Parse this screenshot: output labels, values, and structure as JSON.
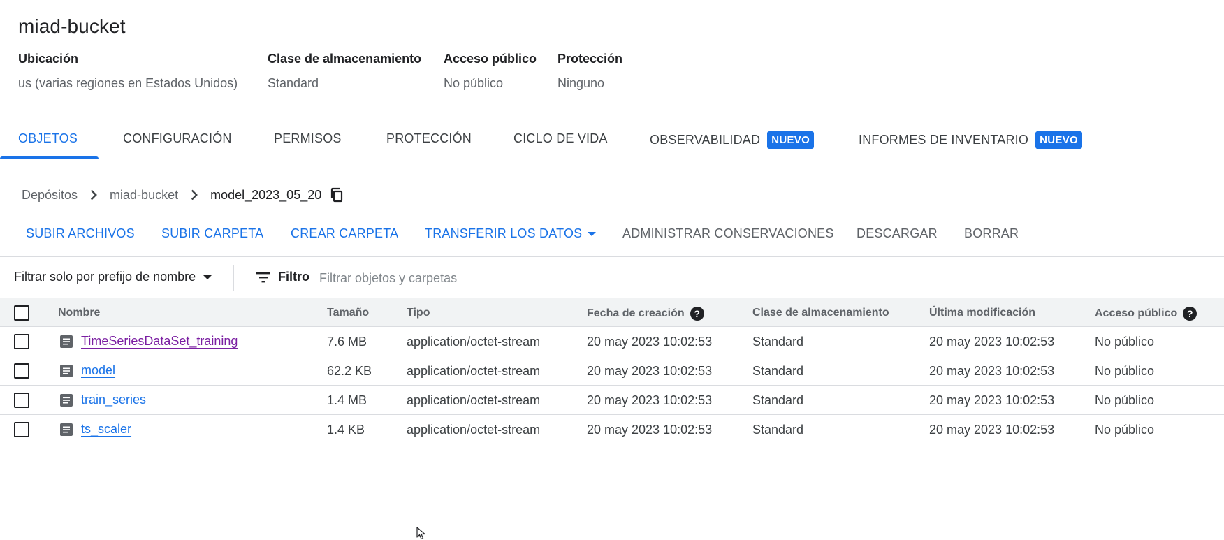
{
  "bucket": {
    "title": "miad-bucket",
    "meta": [
      {
        "label": "Ubicación",
        "value": "us (varias regiones en Estados Unidos)"
      },
      {
        "label": "Clase de almacenamiento",
        "value": "Standard"
      },
      {
        "label": "Acceso público",
        "value": "No público"
      },
      {
        "label": "Protección",
        "value": "Ninguno"
      }
    ]
  },
  "tabs": [
    {
      "label": "OBJETOS",
      "active": true
    },
    {
      "label": "CONFIGURACIÓN"
    },
    {
      "label": "PERMISOS"
    },
    {
      "label": "PROTECCIÓN"
    },
    {
      "label": "CICLO DE VIDA"
    },
    {
      "label": "OBSERVABILIDAD",
      "badge": "NUEVO"
    },
    {
      "label": "INFORMES DE INVENTARIO",
      "badge": "NUEVO"
    }
  ],
  "breadcrumb": {
    "items": [
      "Depósitos",
      "miad-bucket",
      "model_2023_05_20"
    ],
    "copy_icon": "copy-icon"
  },
  "actions": {
    "upload_files": "SUBIR ARCHIVOS",
    "upload_folder": "SUBIR CARPETA",
    "create_folder": "CREAR CARPETA",
    "transfer_data": "TRANSFERIR LOS DATOS",
    "manage_holds": "ADMINISTRAR CONSERVACIONES",
    "download": "DESCARGAR",
    "delete": "BORRAR"
  },
  "filter": {
    "prefix_label": "Filtrar solo por prefijo de nombre",
    "filter_label": "Filtro",
    "placeholder": "Filtrar objetos y carpetas"
  },
  "table": {
    "headers": {
      "name": "Nombre",
      "size": "Tamaño",
      "type": "Tipo",
      "created": "Fecha de creación",
      "storage_class": "Clase de almacenamiento",
      "modified": "Última modificación",
      "public_access": "Acceso público"
    },
    "rows": [
      {
        "name": "TimeSeriesDataSet_training",
        "size": "7.6 MB",
        "type": "application/octet-stream",
        "created": "20 may 2023 10:02:53",
        "storage_class": "Standard",
        "modified": "20 may 2023 10:02:53",
        "public_access": "No público",
        "visited": true
      },
      {
        "name": "model",
        "size": "62.2 KB",
        "type": "application/octet-stream",
        "created": "20 may 2023 10:02:53",
        "storage_class": "Standard",
        "modified": "20 may 2023 10:02:53",
        "public_access": "No público"
      },
      {
        "name": "train_series",
        "size": "1.4 MB",
        "type": "application/octet-stream",
        "created": "20 may 2023 10:02:53",
        "storage_class": "Standard",
        "modified": "20 may 2023 10:02:53",
        "public_access": "No público"
      },
      {
        "name": "ts_scaler",
        "size": "1.4 KB",
        "type": "application/octet-stream",
        "created": "20 may 2023 10:02:53",
        "storage_class": "Standard",
        "modified": "20 may 2023 10:02:53",
        "public_access": "No público"
      }
    ]
  },
  "colors": {
    "accent": "#1a73e8",
    "visited_link": "#7b1fa2",
    "header_bg": "#f1f3f4"
  }
}
